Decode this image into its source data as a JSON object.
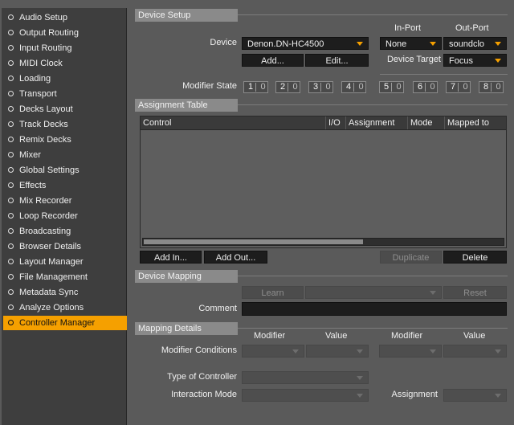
{
  "sidebar": {
    "items": [
      {
        "label": "Audio Setup"
      },
      {
        "label": "Output Routing"
      },
      {
        "label": "Input Routing"
      },
      {
        "label": "MIDI Clock"
      },
      {
        "label": "Loading"
      },
      {
        "label": "Transport"
      },
      {
        "label": "Decks Layout"
      },
      {
        "label": "Track Decks"
      },
      {
        "label": "Remix Decks"
      },
      {
        "label": "Mixer"
      },
      {
        "label": "Global Settings"
      },
      {
        "label": "Effects"
      },
      {
        "label": "Mix Recorder"
      },
      {
        "label": "Loop Recorder"
      },
      {
        "label": "Broadcasting"
      },
      {
        "label": "Browser Details"
      },
      {
        "label": "Layout Manager"
      },
      {
        "label": "File Management"
      },
      {
        "label": "Metadata Sync"
      },
      {
        "label": "Analyze Options"
      },
      {
        "label": "Controller Manager",
        "selected": true
      }
    ],
    "selected_color": "#f5a000"
  },
  "device_setup": {
    "title": "Device Setup",
    "in_port_label": "In-Port",
    "out_port_label": "Out-Port",
    "device_label": "Device",
    "device_value": "Denon.DN-HC4500",
    "in_port_value": "None",
    "out_port_value": "soundclo",
    "add_label": "Add...",
    "edit_label": "Edit...",
    "device_target_label": "Device Target",
    "device_target_value": "Focus",
    "modifier_state_label": "Modifier State",
    "modifiers": [
      {
        "num": "1",
        "val": "0"
      },
      {
        "num": "2",
        "val": "0"
      },
      {
        "num": "3",
        "val": "0"
      },
      {
        "num": "4",
        "val": "0"
      },
      {
        "num": "5",
        "val": "0"
      },
      {
        "num": "6",
        "val": "0"
      },
      {
        "num": "7",
        "val": "0"
      },
      {
        "num": "8",
        "val": "0"
      }
    ]
  },
  "assignment_table": {
    "title": "Assignment Table",
    "columns": [
      "Control",
      "I/O",
      "Assignment",
      "Mode",
      "Mapped to"
    ],
    "rows": [],
    "scroll_fraction": 0.61,
    "add_in_label": "Add In...",
    "add_out_label": "Add Out...",
    "duplicate_label": "Duplicate",
    "delete_label": "Delete"
  },
  "device_mapping": {
    "title": "Device Mapping",
    "learn_label": "Learn",
    "reset_label": "Reset",
    "comment_label": "Comment",
    "comment_value": ""
  },
  "mapping_details": {
    "title": "Mapping Details",
    "modifier_label_1": "Modifier",
    "value_label_1": "Value",
    "modifier_label_2": "Modifier",
    "value_label_2": "Value",
    "modifier_conditions_label": "Modifier Conditions",
    "type_of_controller_label": "Type of Controller",
    "interaction_mode_label": "Interaction Mode",
    "assignment_label": "Assignment"
  },
  "colors": {
    "accent": "#f5a000",
    "panel_bg": "#5a5a5a",
    "sidebar_bg": "#3e3e3e",
    "control_bg": "#1d1d1d",
    "section_header_bg": "#8a8a8a"
  }
}
